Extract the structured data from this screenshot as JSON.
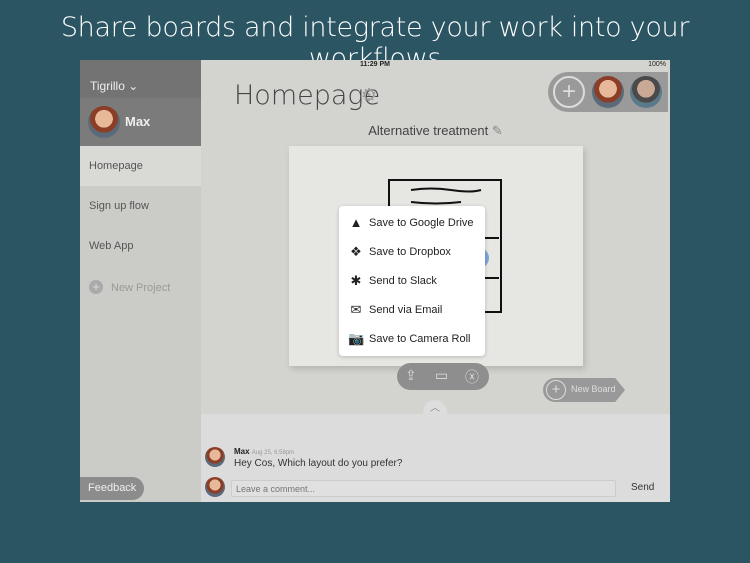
{
  "headline": "Share boards and integrate your work into your workflows",
  "status": {
    "device": "iPad",
    "time": "11:29 PM",
    "battery": "100%"
  },
  "sidebar": {
    "team": "Tigrillo",
    "user": "Max",
    "items": [
      {
        "label": "Homepage",
        "selected": true
      },
      {
        "label": "Sign up flow"
      },
      {
        "label": "Web App"
      }
    ],
    "new_project": "New Project",
    "feedback": "Feedback"
  },
  "main": {
    "title": "Homepage",
    "board_name": "Alternative treatment",
    "new_board": "New Board"
  },
  "share_menu": [
    {
      "icon": "google-drive-icon",
      "label": "Save to Google Drive"
    },
    {
      "icon": "dropbox-icon",
      "label": "Save to Dropbox"
    },
    {
      "icon": "slack-icon",
      "label": "Send to Slack"
    },
    {
      "icon": "email-icon",
      "label": "Send via Email"
    },
    {
      "icon": "camera-icon",
      "label": "Save to Camera Roll"
    }
  ],
  "comments": {
    "items": [
      {
        "author": "Max",
        "time": "Aug 25, 6:58pm",
        "text": "Hey Cos, Which layout do you prefer?"
      }
    ],
    "placeholder": "Leave a comment...",
    "send": "Send"
  }
}
